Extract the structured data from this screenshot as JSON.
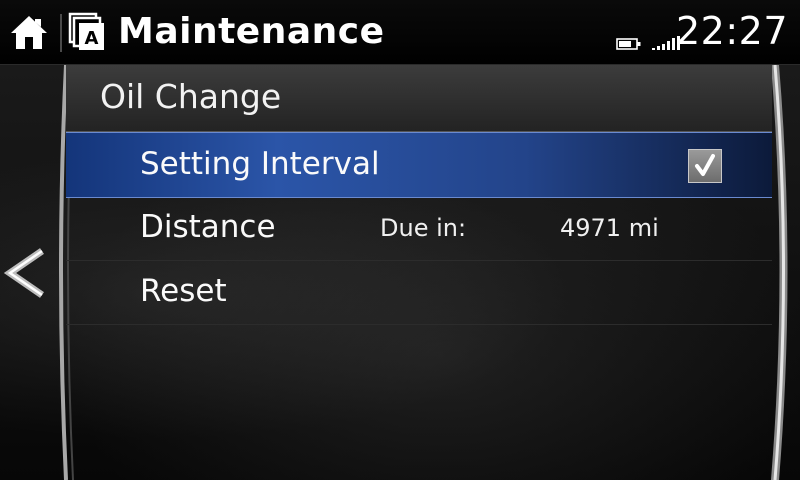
{
  "header": {
    "title": "Maintenance",
    "clock": "22:27",
    "home_icon": "home-icon",
    "source_icon": "audio-source-icon",
    "battery_icon": "battery-icon",
    "signal_icon": "signal-strength-icon"
  },
  "section": {
    "title": "Oil Change"
  },
  "rows": [
    {
      "label": "Setting Interval",
      "checked": true
    },
    {
      "label": "Distance",
      "due_label": "Due in:",
      "due_value": "4971 mi"
    },
    {
      "label": "Reset"
    }
  ],
  "colors": {
    "selection": "#2b55a8",
    "text": "#ffffff",
    "background": "#000000"
  }
}
